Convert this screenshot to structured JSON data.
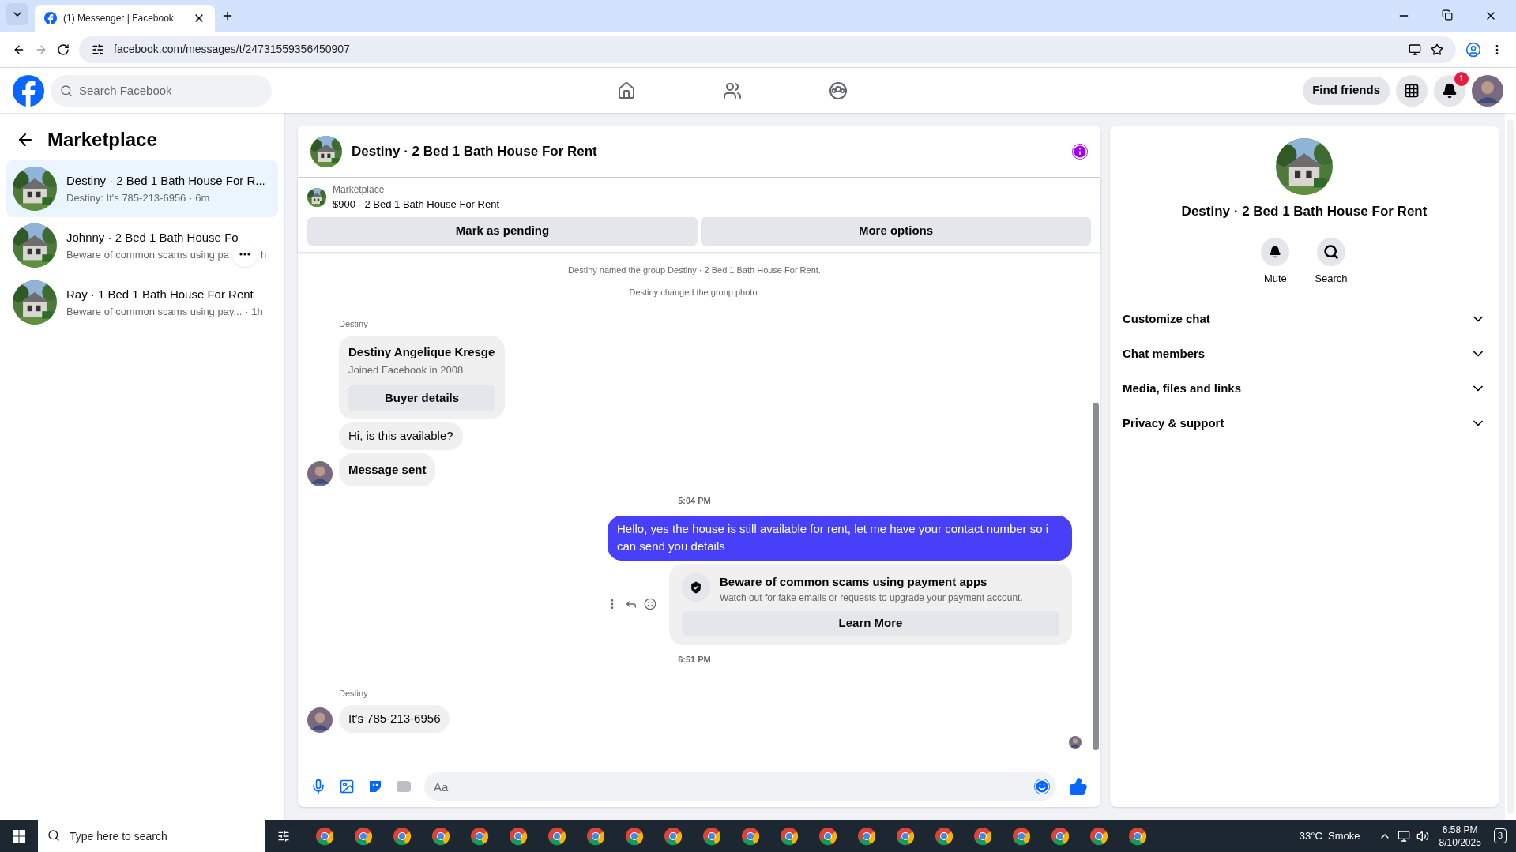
{
  "browser": {
    "tab_title": "(1) Messenger | Facebook",
    "url": "facebook.com/messages/t/24731559356450907"
  },
  "header": {
    "search_placeholder": "Search Facebook",
    "find_friends": "Find friends",
    "notification_count": "1"
  },
  "sidebar": {
    "title": "Marketplace",
    "conversations": [
      {
        "title": "Destiny · 2 Bed 1 Bath House For R...",
        "preview": "Destiny: It's 785-213-6956",
        "time": "· 6m",
        "selected": true,
        "hovered": false
      },
      {
        "title": "Johnny · 2 Bed 1 Bath House Fo",
        "preview": "Beware of common scams using pa",
        "time": "h",
        "selected": false,
        "hovered": true
      },
      {
        "title": "Ray · 1 Bed 1 Bath House For Rent",
        "preview": "Beware of common scams using pay...",
        "time": "· 1h",
        "selected": false,
        "hovered": false
      }
    ]
  },
  "chat": {
    "title": "Destiny · 2 Bed 1 Bath House For Rent",
    "listing": {
      "source": "Marketplace",
      "name": "$900 - 2 Bed 1 Bath House For Rent"
    },
    "actions": [
      "Mark as pending",
      "More options"
    ],
    "messages": [
      {
        "kind": "system",
        "text": "Destiny named the group Destiny · 2 Bed 1 Bath House For Rent."
      },
      {
        "kind": "system",
        "text": "Destiny changed the group photo."
      },
      {
        "kind": "sender",
        "text": "Destiny"
      },
      {
        "kind": "card",
        "name": "Destiny Angelique Kresge",
        "text": "Joined Facebook in 2008",
        "button": "Buyer details"
      },
      {
        "kind": "incoming",
        "text": "Hi, is this available?",
        "avatar": false,
        "bold": false
      },
      {
        "kind": "incoming",
        "text": "Message sent",
        "avatar": true,
        "bold": true
      },
      {
        "kind": "time",
        "text": "5:04 PM"
      },
      {
        "kind": "outgoing",
        "text": "Hello, yes the house is still available for rent, let me have your contact number so i can send you  details"
      },
      {
        "kind": "notice",
        "title": "Beware of common scams using payment apps",
        "text": "Watch out for fake emails or requests to upgrade your payment account.",
        "button": "Learn More"
      },
      {
        "kind": "time",
        "text": "6:51 PM"
      },
      {
        "kind": "sender",
        "text": "Destiny"
      },
      {
        "kind": "incoming",
        "text": "It’s 785-213-6956",
        "avatar": true,
        "bold": false
      }
    ],
    "composer_placeholder": "Aa"
  },
  "details": {
    "title": "Destiny · 2 Bed 1 Bath House For Rent",
    "buttons": [
      "Mute",
      "Search"
    ],
    "sections": [
      "Customize chat",
      "Chat members",
      "Media, files and links",
      "Privacy & support"
    ]
  },
  "taskbar": {
    "search_placeholder": "Type here to search",
    "weather": "33°C  Smoke",
    "time": "6:58 PM",
    "date": "8/10/2025",
    "notifications": "3"
  }
}
